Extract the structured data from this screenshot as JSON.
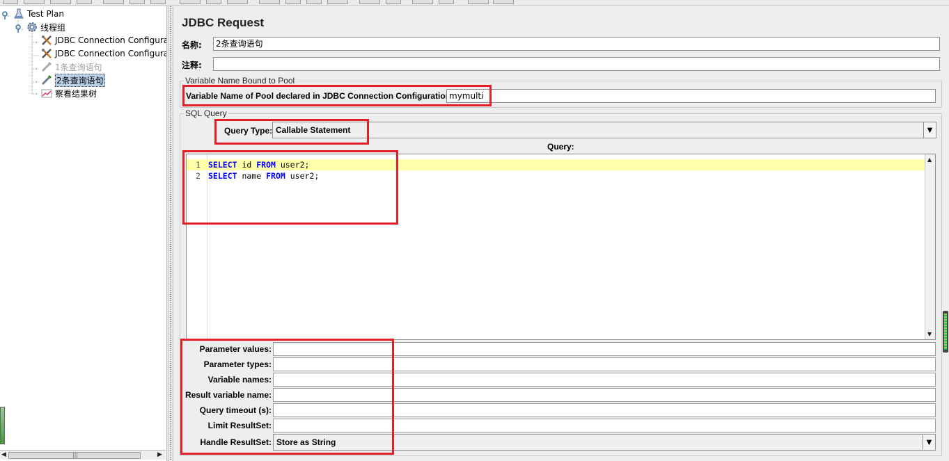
{
  "tree": {
    "items": [
      {
        "label": "Test Plan",
        "icon": "test-plan-icon",
        "state": "normal"
      },
      {
        "label": "线程组",
        "icon": "thread-group-gear-icon",
        "state": "normal"
      },
      {
        "label": "JDBC Connection Configurat",
        "icon": "config-tools-icon",
        "state": "normal"
      },
      {
        "label": "JDBC Connection Configurat",
        "icon": "config-tools-icon",
        "state": "normal"
      },
      {
        "label": "1条查询语句",
        "icon": "sampler-pipette-icon",
        "state": "disabled"
      },
      {
        "label": "2条查询语句",
        "icon": "sampler-pipette-icon",
        "state": "selected"
      },
      {
        "label": "察看结果树",
        "icon": "listener-graph-icon",
        "state": "normal"
      }
    ],
    "scroll_grip": "|||"
  },
  "panel": {
    "title": "JDBC Request",
    "name_label": "名称:",
    "name_value": "2条查询语句",
    "comment_label": "注释:",
    "comment_value": ""
  },
  "pool_section": {
    "legend": "Variable Name Bound to Pool",
    "label": "Variable Name of Pool declared in JDBC Connection Configuration:",
    "value": "mymulti"
  },
  "sql_section": {
    "legend": "SQL Query",
    "query_type_label": "Query Type:",
    "query_type_value": "Callable Statement",
    "query_label": "Query:",
    "lines": [
      {
        "num": "1",
        "kw1": "SELECT",
        "mid": " id ",
        "kw2": "FROM",
        "rest": " user2;"
      },
      {
        "num": "2",
        "kw1": "SELECT",
        "mid": " name ",
        "kw2": "FROM",
        "rest": " user2;"
      }
    ]
  },
  "params": {
    "parameter_values_label": "Parameter values:",
    "parameter_types_label": "Parameter types:",
    "variable_names_label": "Variable names:",
    "result_variable_name_label": "Result variable name:",
    "query_timeout_label": "Query timeout (s):",
    "limit_resultset_label": "Limit ResultSet:",
    "handle_resultset_label": "Handle ResultSet:",
    "handle_resultset_value": "Store as String"
  },
  "colors": {
    "annotation_red": "#e3202a",
    "selection_blue": "#b8cfe5",
    "keyword_blue": "#0000ff",
    "current_line_yellow": "#ffffaa"
  }
}
